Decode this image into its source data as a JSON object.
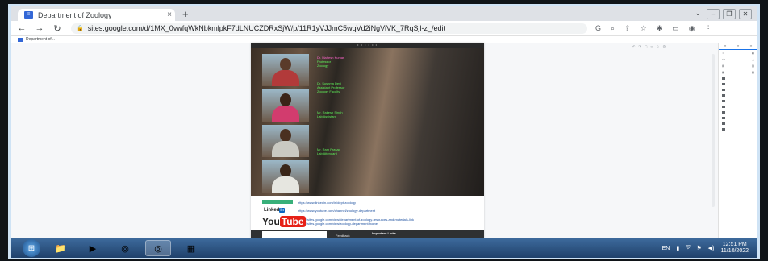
{
  "browser": {
    "tab_title": "Department of Zoology",
    "tab_close": "×",
    "new_tab": "+",
    "url": "sites.google.com/d/1MX_0vwfqWkNbkmlpkF7dLNUCZDRxSjW/p/11R1yVJJmC5wqVd2iNgViVK_7RqSjl-z_/edit",
    "bookmark_label": "Department of..."
  },
  "page": {
    "hero_bar_text": "• • • • • •",
    "faculty": [
      {
        "line1": "Dr. Mahesh Kumar",
        "line2": "Professor",
        "line3": "Zoology"
      },
      {
        "line1": "Dr. Sushma Devi",
        "line2": "Assistant Professor",
        "line3": "Zoology Faculty"
      },
      {
        "line1": "Mr. Rakesh Singh",
        "line2": "Lab Assistant",
        "line3": ""
      },
      {
        "line1": "Mr. Ram Prasad",
        "line2": "Lab Attendant",
        "line3": ""
      }
    ],
    "links": [
      "https://www.linkedin.com/in/dept-zoology",
      "https://www.youtube.com/channel/zoology-department",
      "https://sites.google.com/view/department-of-zoology-resources-and-materials-link",
      "https://sites.google.com/view/zoology-department-home"
    ],
    "linkedin_text": "Linked",
    "linkedin_in": "in",
    "youtube_you": "You",
    "youtube_tube": "Tube",
    "footer_title": "Important Links",
    "footer_sub": "Feedback"
  },
  "taskbar": {
    "lang": "EN",
    "time": "12:51 PM",
    "date": "11/10/2022"
  },
  "colors": {
    "accent": "#1a73e8",
    "caption_green": "#5ff05a",
    "taskbar": "#2b5585"
  }
}
